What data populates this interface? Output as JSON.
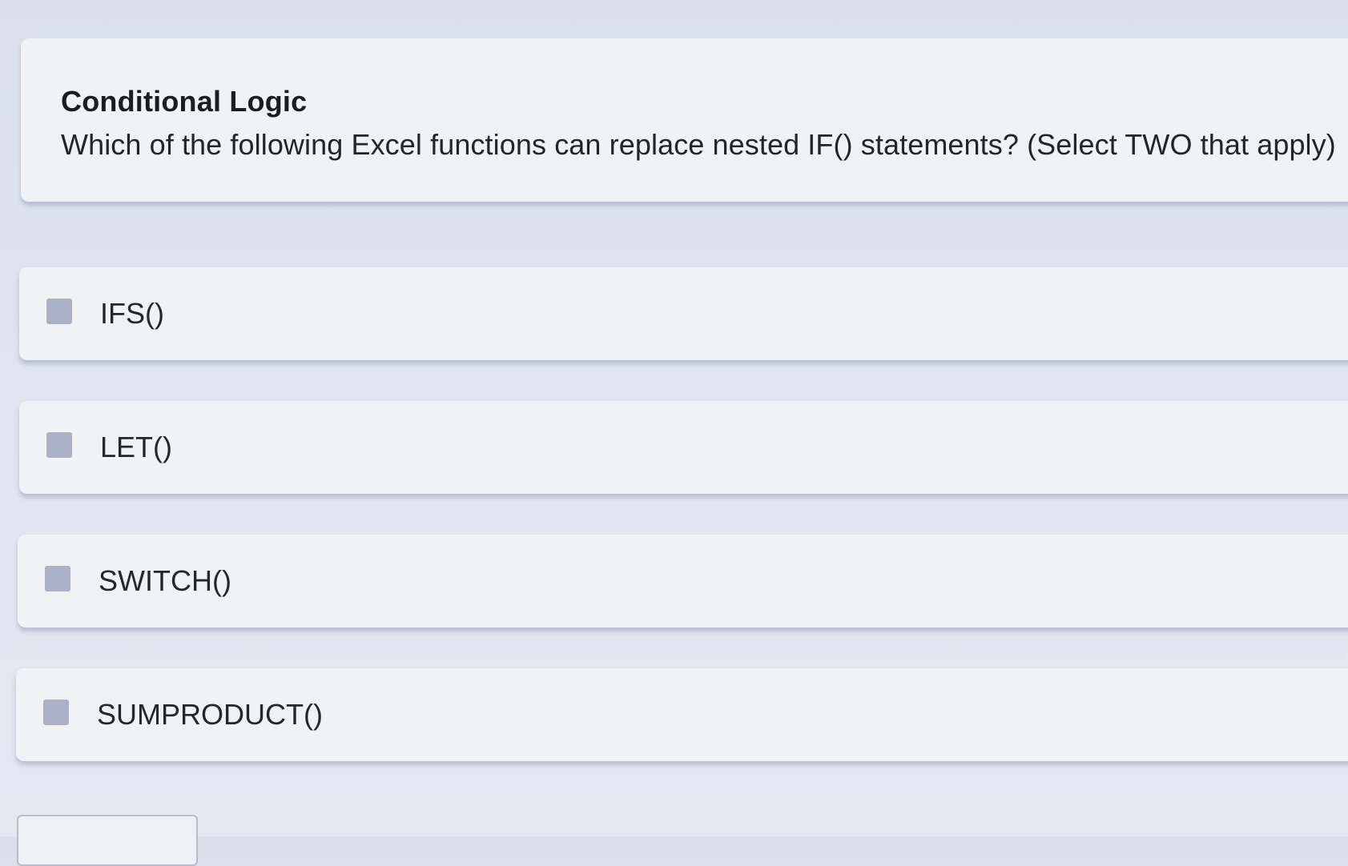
{
  "question": {
    "title": "Conditional Logic",
    "text": "Which of the following Excel functions can replace nested IF() statements? (Select TWO that apply)"
  },
  "options": [
    {
      "label": "IFS()",
      "checked": false
    },
    {
      "label": "LET()",
      "checked": false
    },
    {
      "label": "SWITCH()",
      "checked": false
    },
    {
      "label": "SUMPRODUCT()",
      "checked": false
    }
  ],
  "colors": {
    "background": "#dde3ee",
    "card": "#f1f2f4",
    "checkbox": "#a9b2c9",
    "text": "#24252a"
  }
}
